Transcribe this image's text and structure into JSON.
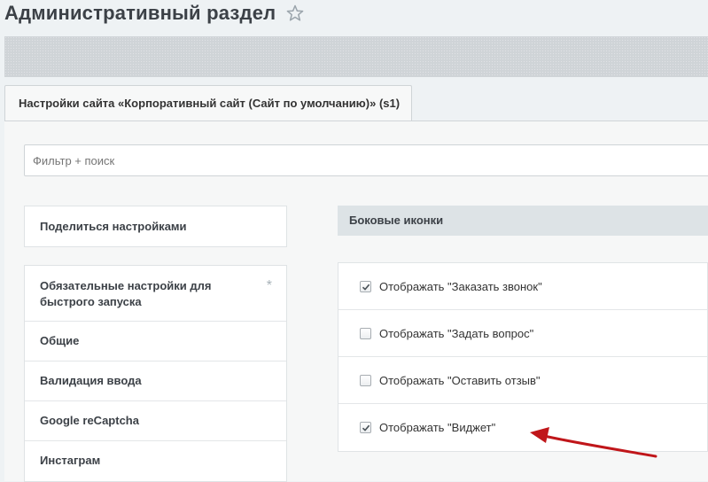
{
  "header": {
    "title": "Административный раздел"
  },
  "tabs": [
    {
      "label": "Настройки сайта «Корпоративный сайт (Сайт по умолчанию)» (s1)"
    }
  ],
  "filter": {
    "placeholder": "Фильтр + поиск"
  },
  "share": {
    "label": "Поделиться настройками"
  },
  "sidebar": {
    "items": [
      {
        "label": "Обязательные настройки для быстрого запуска",
        "badge": "*"
      },
      {
        "label": "Общие"
      },
      {
        "label": "Валидация ввода"
      },
      {
        "label": "Google reCaptcha"
      },
      {
        "label": "Инстаграм"
      }
    ]
  },
  "section": {
    "title": "Боковые иконки",
    "options": [
      {
        "label": "Отображать \"Заказать звонок\"",
        "checked": true
      },
      {
        "label": "Отображать \"Задать вопрос\"",
        "checked": false
      },
      {
        "label": "Отображать \"Оставить отзыв\"",
        "checked": false
      },
      {
        "label": "Отображать \"Виджет\"",
        "checked": true
      }
    ]
  },
  "colors": {
    "annotation_arrow": "#c0161a"
  },
  "icons": {
    "favorite": "star-icon",
    "checked": "checkmark-icon",
    "annotation": "arrow-annotation"
  }
}
